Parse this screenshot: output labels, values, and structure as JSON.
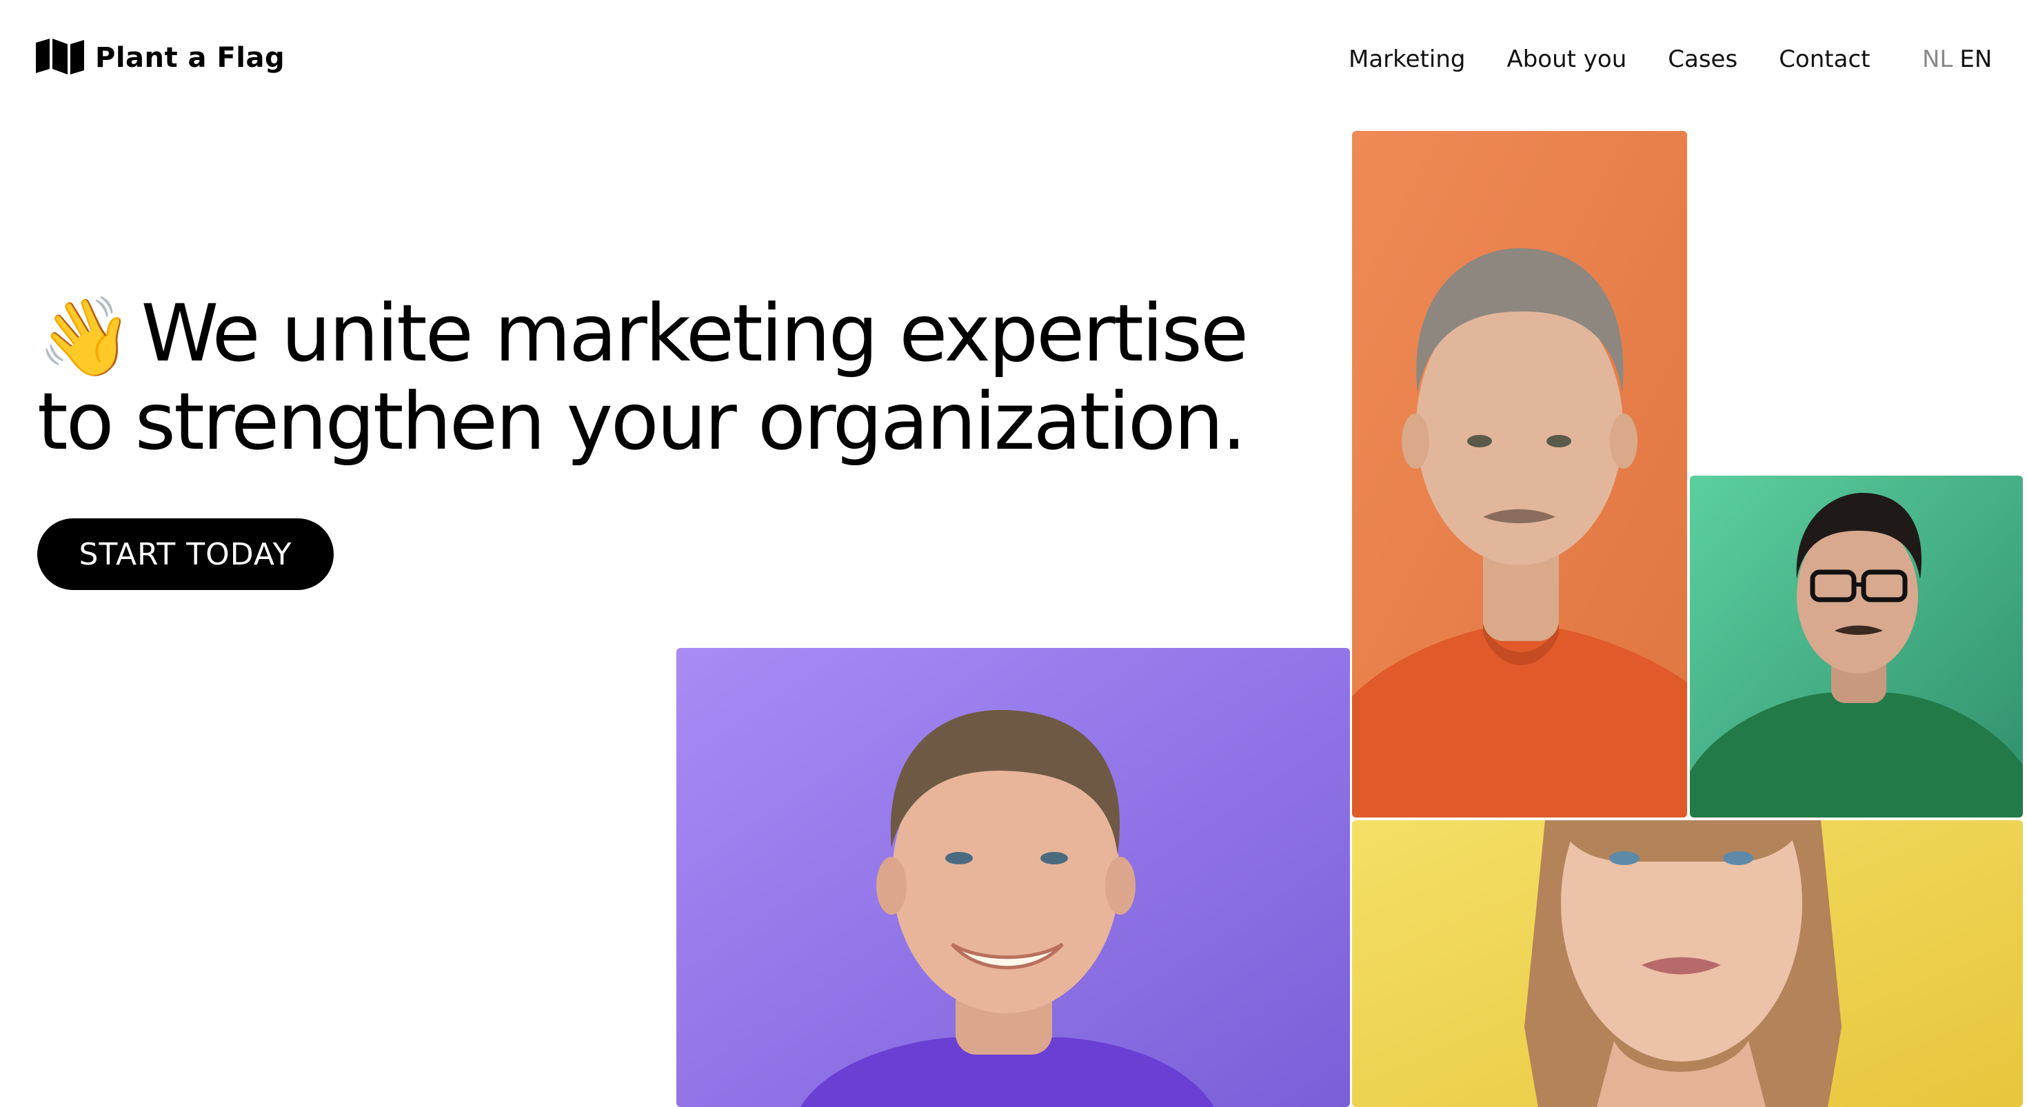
{
  "header": {
    "logo_text": "Plant a Flag",
    "logo_icon": "flag-icon",
    "nav": [
      {
        "label": "Marketing"
      },
      {
        "label": "About you"
      },
      {
        "label": "Cases"
      },
      {
        "label": "Contact"
      }
    ],
    "languages": [
      {
        "label": "NL",
        "active": false
      },
      {
        "label": "EN",
        "active": true
      }
    ]
  },
  "hero": {
    "emoji": "👋",
    "emoji_icon": "waving-hand-icon",
    "headline_line1": "We unite marketing expertise",
    "headline_line2": "to strengthen your organization.",
    "cta_label": "START TODAY"
  },
  "photos": [
    {
      "name": "photo-man-orange",
      "background": "#e9824f"
    },
    {
      "name": "photo-man-green",
      "background": "#45b88a"
    },
    {
      "name": "photo-man-purple",
      "background": "#9a7ff0"
    },
    {
      "name": "photo-woman-yellow",
      "background": "#f1d85a"
    }
  ],
  "colors": {
    "text": "#000000",
    "muted": "#8a8a8a",
    "background": "#ffffff",
    "button": "#000000",
    "button_text": "#ffffff"
  }
}
